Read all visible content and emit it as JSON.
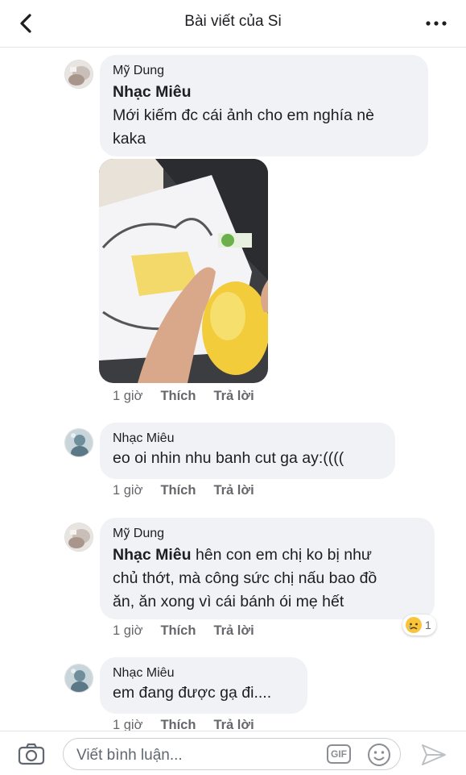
{
  "header": {
    "title": "Bài viết của Si"
  },
  "comments": [
    {
      "author": "Mỹ Dung",
      "mention": "Nhạc Miêu",
      "line1": "Mới kiếm đc cái ảnh cho em nghía nè",
      "line2": "kaka",
      "time": "1 giờ",
      "like": "Thích",
      "reply": "Trả lời"
    },
    {
      "author": "Nhạc Miêu",
      "line1": "eo oi nhin nhu banh cut ga ay:((((",
      "time": "1 giờ",
      "like": "Thích",
      "reply": "Trả lời"
    },
    {
      "author": "Mỹ Dung",
      "mention": "Nhạc Miêu",
      "line1": "hên con em chị ko bị như",
      "line2": "chủ thớt, mà công sức chị nấu bao đồ",
      "line3": "ăn, ăn xong vì cái bánh ói mẹ hết",
      "time": "1 giờ",
      "like": "Thích",
      "reply": "Trả lời",
      "reaction": {
        "icon": "sad-face-icon",
        "count": "1"
      }
    },
    {
      "author": "Nhạc Miêu",
      "line1": "em đang được gạ đi....",
      "time": "1 giờ",
      "like": "Thích",
      "reply": "Trả lời"
    }
  ],
  "composer": {
    "placeholder": "Viết bình luận...",
    "gif_label": "GIF"
  },
  "colors": {
    "bubble": "#f0f2f5",
    "meta": "#65676b",
    "text": "#1c1e21"
  }
}
